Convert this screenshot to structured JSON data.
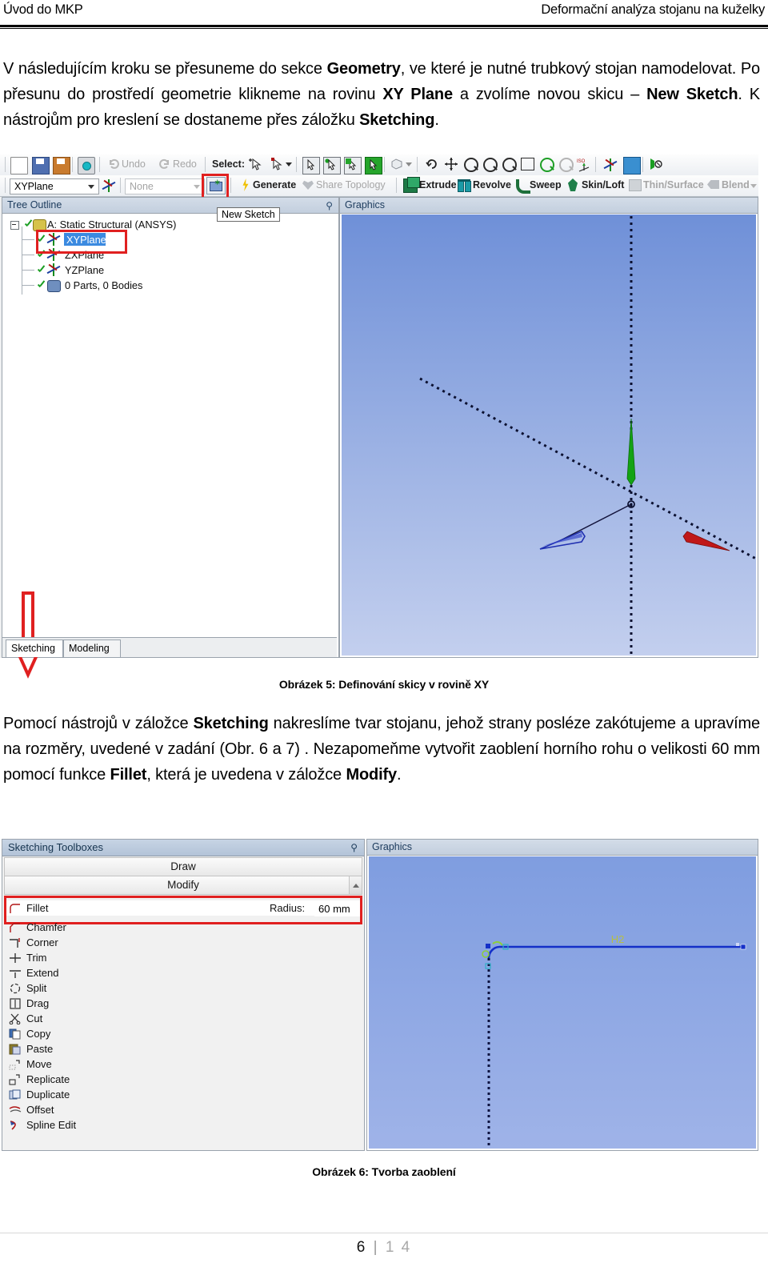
{
  "header": {
    "left": "Úvod do MKP",
    "right": "Deformační analýza stojanu na kuželky"
  },
  "paragraph1_html": "V následujícím kroku se přesuneme do sekce <b>Geometry</b>, ve které je nutné trubkový stojan namodelovat. Po přesunu do prostředí geometrie klikneme na rovinu <b>XY Plane</b> a zvolíme novou skicu – <b>New Sketch</b>. K nástrojům pro kreslení se dostaneme přes záložku <b>Sketching</b>.",
  "paragraph2_html": "Pomocí nástrojů v záložce <b>Sketching</b> nakreslíme tvar stojanu, jehož strany posléze zakótujeme a upravíme na rozměry, uvedené v zadání (Obr. 6 a 7) . Nezapomeňme vytvořit zaoblení horního rohu o velikosti 60 mm pomocí funkce <b>Fillet</b>, která je uvedena v záložce <b>Modify</b>.",
  "caption1": "Obrázek 5: Definování skicy v rovině XY",
  "caption2": "Obrázek 6: Tvorba zaoblení",
  "footer": {
    "page": "6",
    "separator": "|",
    "total": "1 4"
  },
  "figure5": {
    "toolbar_row1": {
      "icons": [
        "new-page-icon",
        "save-icon",
        "save-as-icon",
        "screenshot-icon"
      ],
      "undo_label": "Undo",
      "redo_label": "Redo",
      "select_label": "Select:",
      "select_icons": [
        "single-select-icon",
        "box-select-icon",
        "vertex-filter-icon",
        "edge-filter-icon",
        "face-filter-icon",
        "body-filter-icon"
      ],
      "view_icons": [
        "rotate-icon",
        "pan-icon",
        "zoom-icon",
        "box-zoom-icon",
        "zoom-to-fit-icon",
        "magnifier-icon",
        "zoom-in-icon",
        "zoom-out-icon",
        "iso-view-icon",
        "plane-icon",
        "body-icon",
        "look-at-icon"
      ]
    },
    "toolbar_row2": {
      "plane_value": "XYPlane",
      "sketch_value": "None",
      "new_sketch_icon": "new-sketch-icon",
      "generate_label": "Generate",
      "share_topology_label": "Share Topology",
      "extrude_label": "Extrude",
      "revolve_label": "Revolve",
      "sweep_label": "Sweep",
      "skinloft_label": "Skin/Loft",
      "thinsurface_label": "Thin/Surface",
      "blend_label": "Blend"
    },
    "tree_panel": {
      "title": "Tree Outline",
      "pin_icon": "pin-icon",
      "items": [
        {
          "label": "A: Static Structural (ANSYS)",
          "icon": "project-icon",
          "depth": 0,
          "selected": false
        },
        {
          "label": "XYPlane",
          "icon": "plane-icon",
          "depth": 1,
          "selected": true
        },
        {
          "label": "ZXPlane",
          "icon": "plane-icon",
          "depth": 1,
          "selected": false
        },
        {
          "label": "YZPlane",
          "icon": "plane-icon",
          "depth": 1,
          "selected": false
        },
        {
          "label": "0 Parts, 0 Bodies",
          "icon": "bodies-icon",
          "depth": 1,
          "selected": false
        }
      ]
    },
    "tooltip": "New Sketch",
    "tabs": [
      {
        "label": "Sketching",
        "active": true
      },
      {
        "label": "Modeling",
        "active": false
      }
    ],
    "graphics": {
      "title": "Graphics",
      "axis_colors": {
        "x": "#b01515",
        "y": "#1a9e22",
        "z": "#2030b0"
      }
    },
    "annotation_color": "#e02020"
  },
  "figure6": {
    "panel_title": "Sketching Toolboxes",
    "pin_icon": "pin-icon",
    "groups": [
      {
        "label": "Draw",
        "has_scroll": false
      },
      {
        "label": "Modify",
        "has_scroll": true
      }
    ],
    "fillet": {
      "label": "Fillet",
      "icon": "fillet-icon",
      "radius_label": "Radius:",
      "radius_value": "60 mm"
    },
    "items": [
      {
        "label": "Chamfer",
        "icon": "chamfer-icon"
      },
      {
        "label": "Corner",
        "icon": "corner-icon"
      },
      {
        "label": "Trim",
        "icon": "trim-icon"
      },
      {
        "label": "Extend",
        "icon": "extend-icon"
      },
      {
        "label": "Split",
        "icon": "split-icon"
      },
      {
        "label": "Drag",
        "icon": "drag-icon"
      },
      {
        "label": "Cut",
        "icon": "cut-icon"
      },
      {
        "label": "Copy",
        "icon": "copy-icon"
      },
      {
        "label": "Paste",
        "icon": "paste-icon"
      },
      {
        "label": "Move",
        "icon": "move-icon"
      },
      {
        "label": "Replicate",
        "icon": "replicate-icon"
      },
      {
        "label": "Duplicate",
        "icon": "duplicate-icon"
      },
      {
        "label": "Offset",
        "icon": "offset-icon"
      },
      {
        "label": "Spline Edit",
        "icon": "spline-edit-icon"
      }
    ],
    "graphics": {
      "title": "Graphics",
      "dimension_label": "H2"
    },
    "annotation_color": "#e02020"
  }
}
